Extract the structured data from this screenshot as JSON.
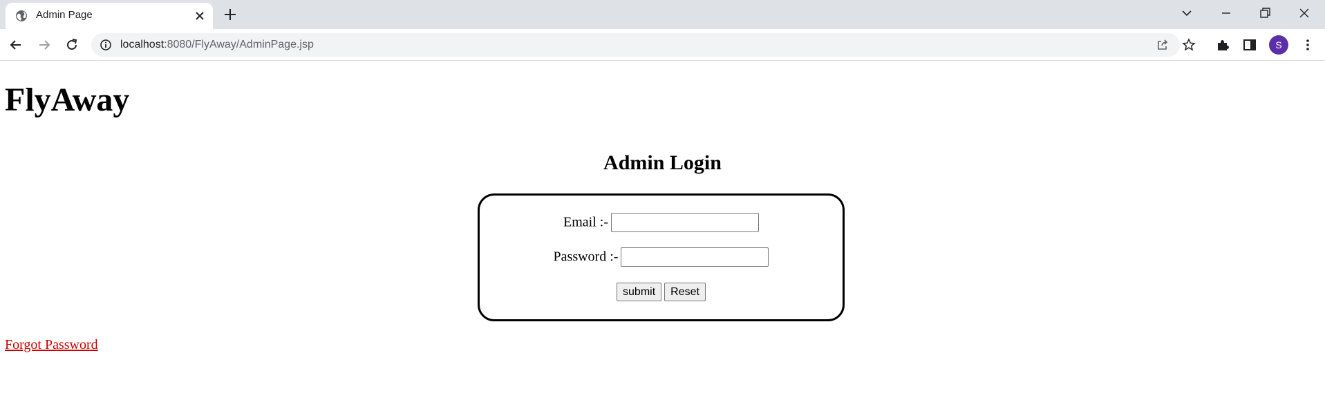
{
  "browser": {
    "tab": {
      "title": "Admin Page",
      "favicon": "globe-icon"
    },
    "address": {
      "host": "localhost",
      "path": ":8080/FlyAway/AdminPage.jsp"
    },
    "profile_initial": "S",
    "profile_color": "#5b2fa8"
  },
  "page": {
    "site_title": "FlyAway",
    "login_heading": "Admin Login",
    "form": {
      "email_label": "Email :-",
      "email_value": "",
      "password_label": "Password :-",
      "password_value": "",
      "submit_label": "submit",
      "reset_label": "Reset"
    },
    "forgot_link": "Forgot Password",
    "link_color": "#cc0000"
  }
}
